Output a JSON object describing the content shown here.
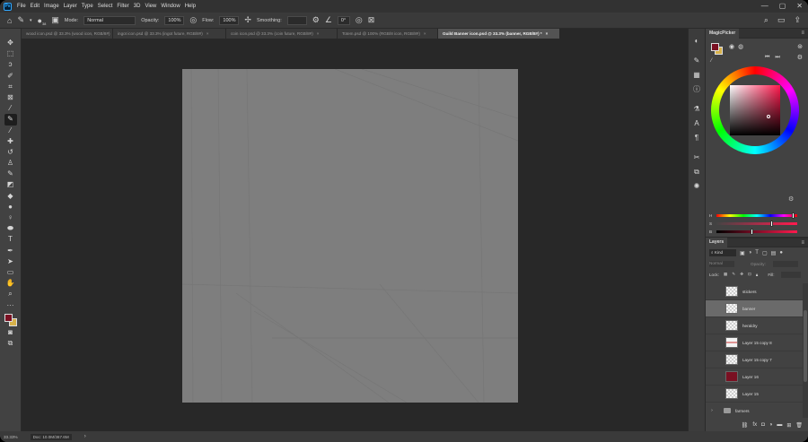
{
  "menubar": {
    "logo": "Ps",
    "items": [
      "File",
      "Edit",
      "Image",
      "Layer",
      "Type",
      "Select",
      "Filter",
      "3D",
      "View",
      "Window",
      "Help"
    ]
  },
  "options": {
    "brush_size": "38",
    "mode_label": "Mode:",
    "mode_value": "Normal",
    "opacity_label": "Opacity:",
    "opacity_value": "100%",
    "flow_label": "Flow:",
    "flow_value": "100%",
    "smoothing_label": "Smoothing:",
    "smoothing_value": "",
    "angle_value": "0°"
  },
  "tabs": [
    {
      "label": "wood icon.psd @ 33.3% (wood icon, RGB/8#)",
      "active": false
    },
    {
      "label": "ingot icon.psd @ 33.3% (ingot future, RGB/8#)",
      "active": false
    },
    {
      "label": "coin icon.psd @ 33.3% (coin future, RGB/8#)",
      "active": false
    },
    {
      "label": "Totem.psd @ 100% (RGB/8 icon, RGB/8#)",
      "active": false
    },
    {
      "label": "Guild Banner icon.psd @ 33.3% (banner, RGB/8#) *",
      "active": true
    }
  ],
  "status": {
    "zoom": "33.33%",
    "doc": "Doc: 10.0M/367.6M"
  },
  "panel": {
    "magicpicker_tab": "MagicPicker",
    "layers_tab": "Layers",
    "kind_label": "Kind",
    "blend_value": "Normal",
    "opacity_label": "Opacity:",
    "lock_label": "Lock:",
    "fill_label": "Fill:",
    "sliders": [
      "H",
      "S",
      "B"
    ]
  },
  "colors": {
    "foreground": "#7a1022",
    "background": "#d8b24a",
    "canvas": "#7e7e7e"
  },
  "layers": [
    {
      "name": "stickers",
      "thumb": "checker",
      "selected": false,
      "group": false
    },
    {
      "name": "banner",
      "thumb": "checker",
      "selected": true,
      "group": false
    },
    {
      "name": "heraldry",
      "thumb": "checker",
      "selected": false,
      "group": false
    },
    {
      "name": "Layer 15 copy 8",
      "thumb": "lines",
      "selected": false,
      "group": false
    },
    {
      "name": "Layer 15 copy 7",
      "thumb": "checker",
      "selected": false,
      "group": false
    },
    {
      "name": "Layer 16",
      "thumb": "red",
      "selected": false,
      "group": false
    },
    {
      "name": "Layer 15",
      "thumb": "checker",
      "selected": false,
      "group": false
    },
    {
      "name": "farmers",
      "thumb": "folder",
      "selected": false,
      "group": true
    }
  ]
}
